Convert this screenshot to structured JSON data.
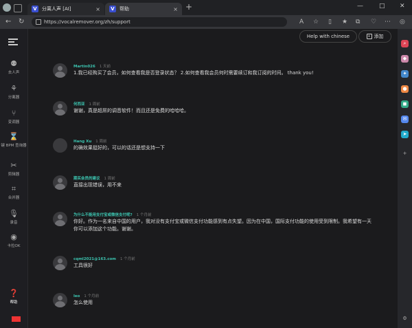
{
  "browser": {
    "tabs": [
      {
        "label": "分离人声 [AI]",
        "favicon": "V",
        "close": "×"
      },
      {
        "label": "帮助",
        "favicon": "V",
        "close": "×"
      }
    ],
    "new_tab": "+",
    "window_controls": {
      "minimize": "—",
      "maximize": "□",
      "close": "✕"
    },
    "url": "https://vocalremover.org/zh/support",
    "nav": {
      "back": "←",
      "reload": "↻"
    }
  },
  "sidebar": {
    "items": [
      {
        "label": "去人声",
        "icon": "person-voice-icon"
      },
      {
        "label": "分离器",
        "icon": "splitter-icon"
      },
      {
        "label": "变调器",
        "icon": "pitch-icon"
      },
      {
        "label": "键 BPM 查询器",
        "icon": "bpm-icon"
      },
      {
        "label": "剪辑器",
        "icon": "scissors-icon"
      },
      {
        "label": "合并器",
        "icon": "joiner-icon"
      },
      {
        "label": "录音",
        "icon": "mic-icon"
      },
      {
        "label": "卡拉OK",
        "icon": "karaoke-icon"
      },
      {
        "label": "帮助",
        "icon": "help-icon"
      }
    ]
  },
  "header": {
    "help_chinese": "Help with chinese",
    "add_label": "添加"
  },
  "comments": [
    {
      "author": "Martin026",
      "time": "1 天前",
      "text": "1.我已经购买了会员，如何查看我是否登录状态？ 2.如何查看我会员何时需要续订和我订阅的时间。 thank you!"
    },
    {
      "author": "何西亚",
      "time": "1 周前",
      "text": "谢谢，真是超屌的调音软件！而且还是免费的哈哈哈。"
    },
    {
      "author": "Hang Xu",
      "time": "1 周前",
      "text": "的确效果挺好的，可以的话还是想支持一下"
    },
    {
      "author": "期买会员的建议",
      "time": "1 周前",
      "text": "直接出现错误，用不来"
    },
    {
      "author": "为什么不能用支付宝或微信支付呢?",
      "time": "1 个月前",
      "text": "你好。作为一名来自中国的用户，我对没有支付宝或微信支付功能感到有点失望。因为在中国，国际支付功能的使用受到限制。我希望有一天你可以添加这个功能。谢谢。"
    },
    {
      "author": "cqml2021@163.com",
      "time": "1 个月前",
      "text": "工具很好"
    },
    {
      "author": "leo",
      "time": "1 个月前",
      "text": "怎么使用"
    }
  ],
  "colors": {
    "accent": "#3cc4b0",
    "background": "#1b1b1d",
    "sidebar": "#1e1e22"
  }
}
